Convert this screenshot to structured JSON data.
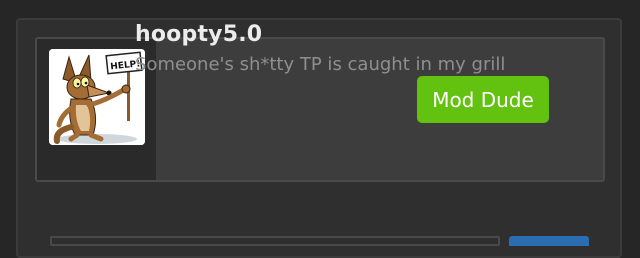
{
  "profile": {
    "username": "hoopty5.0",
    "tagline": "Someone's sh*tty TP is caught in my grill",
    "role_badge": "Mod Dude",
    "avatar_sign_text": "HELP!"
  },
  "colors": {
    "badge": "#63c110",
    "background": "#262626",
    "card": "#3d3d3d",
    "accent_button": "#2a6db0"
  }
}
